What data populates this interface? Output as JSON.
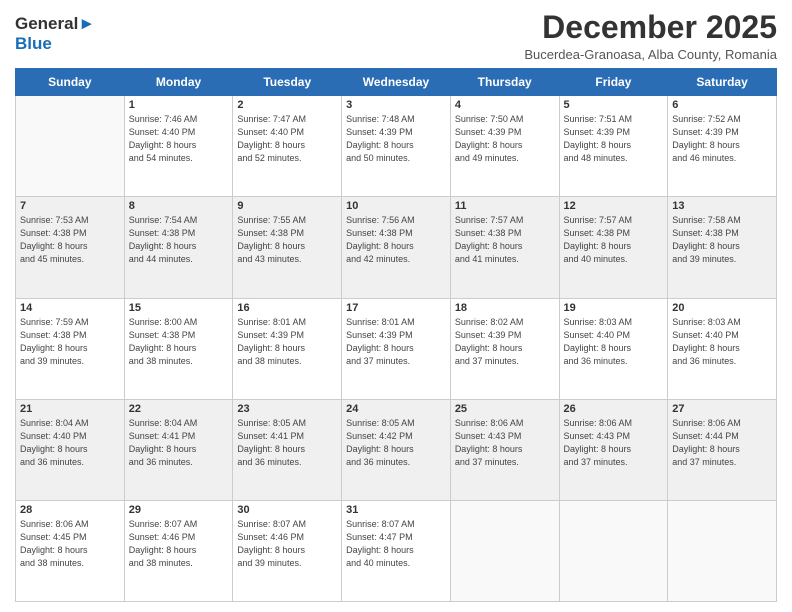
{
  "header": {
    "logo_line1": "General",
    "logo_line2": "Blue",
    "month_title": "December 2025",
    "subtitle": "Bucerdea-Granoasa, Alba County, Romania"
  },
  "days_of_week": [
    "Sunday",
    "Monday",
    "Tuesday",
    "Wednesday",
    "Thursday",
    "Friday",
    "Saturday"
  ],
  "weeks": [
    {
      "shaded": false,
      "days": [
        {
          "num": "",
          "info": ""
        },
        {
          "num": "1",
          "info": "Sunrise: 7:46 AM\nSunset: 4:40 PM\nDaylight: 8 hours\nand 54 minutes."
        },
        {
          "num": "2",
          "info": "Sunrise: 7:47 AM\nSunset: 4:40 PM\nDaylight: 8 hours\nand 52 minutes."
        },
        {
          "num": "3",
          "info": "Sunrise: 7:48 AM\nSunset: 4:39 PM\nDaylight: 8 hours\nand 50 minutes."
        },
        {
          "num": "4",
          "info": "Sunrise: 7:50 AM\nSunset: 4:39 PM\nDaylight: 8 hours\nand 49 minutes."
        },
        {
          "num": "5",
          "info": "Sunrise: 7:51 AM\nSunset: 4:39 PM\nDaylight: 8 hours\nand 48 minutes."
        },
        {
          "num": "6",
          "info": "Sunrise: 7:52 AM\nSunset: 4:39 PM\nDaylight: 8 hours\nand 46 minutes."
        }
      ]
    },
    {
      "shaded": true,
      "days": [
        {
          "num": "7",
          "info": "Sunrise: 7:53 AM\nSunset: 4:38 PM\nDaylight: 8 hours\nand 45 minutes."
        },
        {
          "num": "8",
          "info": "Sunrise: 7:54 AM\nSunset: 4:38 PM\nDaylight: 8 hours\nand 44 minutes."
        },
        {
          "num": "9",
          "info": "Sunrise: 7:55 AM\nSunset: 4:38 PM\nDaylight: 8 hours\nand 43 minutes."
        },
        {
          "num": "10",
          "info": "Sunrise: 7:56 AM\nSunset: 4:38 PM\nDaylight: 8 hours\nand 42 minutes."
        },
        {
          "num": "11",
          "info": "Sunrise: 7:57 AM\nSunset: 4:38 PM\nDaylight: 8 hours\nand 41 minutes."
        },
        {
          "num": "12",
          "info": "Sunrise: 7:57 AM\nSunset: 4:38 PM\nDaylight: 8 hours\nand 40 minutes."
        },
        {
          "num": "13",
          "info": "Sunrise: 7:58 AM\nSunset: 4:38 PM\nDaylight: 8 hours\nand 39 minutes."
        }
      ]
    },
    {
      "shaded": false,
      "days": [
        {
          "num": "14",
          "info": "Sunrise: 7:59 AM\nSunset: 4:38 PM\nDaylight: 8 hours\nand 39 minutes."
        },
        {
          "num": "15",
          "info": "Sunrise: 8:00 AM\nSunset: 4:38 PM\nDaylight: 8 hours\nand 38 minutes."
        },
        {
          "num": "16",
          "info": "Sunrise: 8:01 AM\nSunset: 4:39 PM\nDaylight: 8 hours\nand 38 minutes."
        },
        {
          "num": "17",
          "info": "Sunrise: 8:01 AM\nSunset: 4:39 PM\nDaylight: 8 hours\nand 37 minutes."
        },
        {
          "num": "18",
          "info": "Sunrise: 8:02 AM\nSunset: 4:39 PM\nDaylight: 8 hours\nand 37 minutes."
        },
        {
          "num": "19",
          "info": "Sunrise: 8:03 AM\nSunset: 4:40 PM\nDaylight: 8 hours\nand 36 minutes."
        },
        {
          "num": "20",
          "info": "Sunrise: 8:03 AM\nSunset: 4:40 PM\nDaylight: 8 hours\nand 36 minutes."
        }
      ]
    },
    {
      "shaded": true,
      "days": [
        {
          "num": "21",
          "info": "Sunrise: 8:04 AM\nSunset: 4:40 PM\nDaylight: 8 hours\nand 36 minutes."
        },
        {
          "num": "22",
          "info": "Sunrise: 8:04 AM\nSunset: 4:41 PM\nDaylight: 8 hours\nand 36 minutes."
        },
        {
          "num": "23",
          "info": "Sunrise: 8:05 AM\nSunset: 4:41 PM\nDaylight: 8 hours\nand 36 minutes."
        },
        {
          "num": "24",
          "info": "Sunrise: 8:05 AM\nSunset: 4:42 PM\nDaylight: 8 hours\nand 36 minutes."
        },
        {
          "num": "25",
          "info": "Sunrise: 8:06 AM\nSunset: 4:43 PM\nDaylight: 8 hours\nand 37 minutes."
        },
        {
          "num": "26",
          "info": "Sunrise: 8:06 AM\nSunset: 4:43 PM\nDaylight: 8 hours\nand 37 minutes."
        },
        {
          "num": "27",
          "info": "Sunrise: 8:06 AM\nSunset: 4:44 PM\nDaylight: 8 hours\nand 37 minutes."
        }
      ]
    },
    {
      "shaded": false,
      "days": [
        {
          "num": "28",
          "info": "Sunrise: 8:06 AM\nSunset: 4:45 PM\nDaylight: 8 hours\nand 38 minutes."
        },
        {
          "num": "29",
          "info": "Sunrise: 8:07 AM\nSunset: 4:46 PM\nDaylight: 8 hours\nand 38 minutes."
        },
        {
          "num": "30",
          "info": "Sunrise: 8:07 AM\nSunset: 4:46 PM\nDaylight: 8 hours\nand 39 minutes."
        },
        {
          "num": "31",
          "info": "Sunrise: 8:07 AM\nSunset: 4:47 PM\nDaylight: 8 hours\nand 40 minutes."
        },
        {
          "num": "",
          "info": ""
        },
        {
          "num": "",
          "info": ""
        },
        {
          "num": "",
          "info": ""
        }
      ]
    }
  ]
}
